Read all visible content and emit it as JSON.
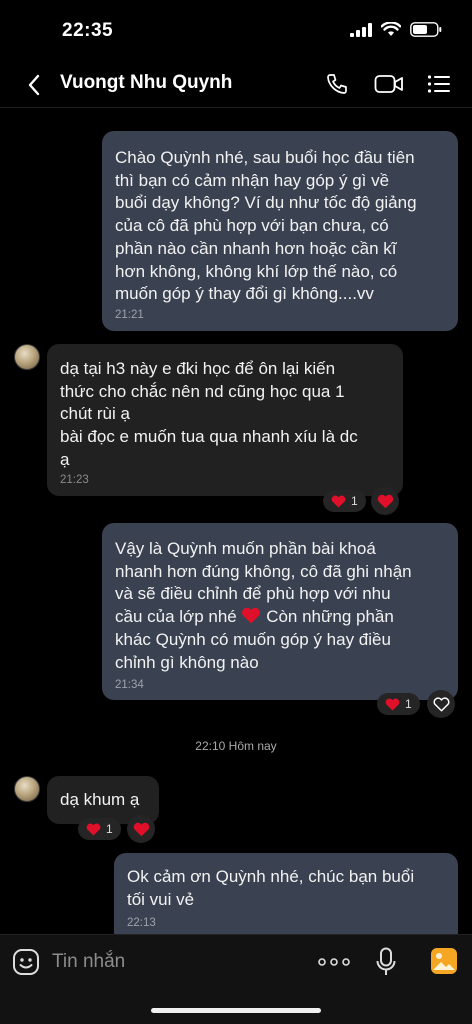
{
  "status": {
    "time": "22:35"
  },
  "header": {
    "contact_name": "Vuongt Nhu Quynh"
  },
  "messages": [
    {
      "direction": "out",
      "text": "Chào Quỳnh nhé, sau buổi học đầu tiên\nthì bạn có cảm nhận hay góp ý gì về\nbuổi dạy không? Ví dụ như tốc độ giảng\ncủa cô đã phù hợp với bạn chưa, có\nphần nào cần nhanh hơn hoặc cần kĩ\nhơn không, không khí lớp thế nào, có\nmuốn góp ý thay đổi gì không....vv",
      "time": "21:21"
    },
    {
      "direction": "in",
      "text": "dạ tại h3 này e đki học để ôn lại kiến\nthức cho chắc nên nd cũng học qua 1\nchút rùi ạ\nbài đọc e muốn tua qua nhanh xíu là dc\nạ",
      "time": "21:23",
      "reaction_count": "1"
    },
    {
      "direction": "out",
      "text": "Vậy là Quỳnh muốn phần bài khoá\nnhanh hơn đúng không, cô đã ghi nhận\nvà sẽ điều chỉnh để phù hợp với nhu\ncầu của lớp nhé",
      "text_tail": " Còn những phần\nkhác Quỳnh có muốn góp ý hay điều\nchỉnh gì không nào",
      "time": "21:34",
      "reaction_count": "1"
    },
    {
      "direction": "in",
      "text": "dạ khum ạ",
      "reaction_count": "1"
    },
    {
      "direction": "out",
      "text": "Ok cảm ơn Quỳnh nhé, chúc bạn buổi\ntối vui vẻ",
      "time": "22:13"
    }
  ],
  "day_separator": "22:10 Hôm nay",
  "composer": {
    "placeholder": "Tin nhắn"
  },
  "colors": {
    "bubble_out": "#3a4150",
    "bubble_in": "#212121",
    "heart": "#e0102a",
    "accent": "#f5a623"
  }
}
